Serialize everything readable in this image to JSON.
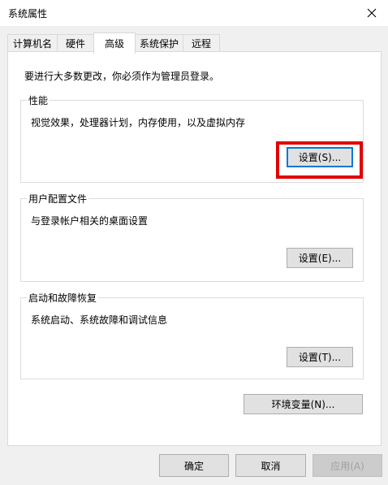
{
  "window": {
    "title": "系统属性"
  },
  "tabs": [
    {
      "label": "计算机名"
    },
    {
      "label": "硬件"
    },
    {
      "label": "高级"
    },
    {
      "label": "系统保护"
    },
    {
      "label": "远程"
    }
  ],
  "intro_text": "要进行大多数更改，你必须作为管理员登录。",
  "performance": {
    "title": "性能",
    "description": "视觉效果，处理器计划，内存使用，以及虚拟内存",
    "button_label": "设置(S)..."
  },
  "user_profiles": {
    "title": "用户配置文件",
    "description": "与登录帐户相关的桌面设置",
    "button_label": "设置(E)..."
  },
  "startup_recovery": {
    "title": "启动和故障恢复",
    "description": "系统启动、系统故障和调试信息",
    "button_label": "设置(T)..."
  },
  "env_vars_label": "环境变量(N)...",
  "footer": {
    "ok_label": "确定",
    "cancel_label": "取消",
    "apply_label": "应用(A)"
  },
  "colors": {
    "highlight": "#e00000",
    "focus": "#0078d7"
  }
}
